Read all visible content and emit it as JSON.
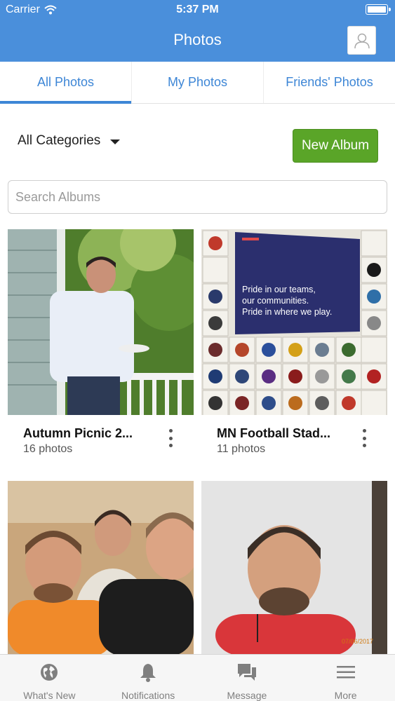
{
  "status_bar": {
    "carrier": "Carrier",
    "time": "5:37 PM"
  },
  "header": {
    "title": "Photos"
  },
  "tabs": [
    {
      "label": "All Photos",
      "active": true
    },
    {
      "label": "My Photos",
      "active": false
    },
    {
      "label": "Friends' Photos",
      "active": false
    }
  ],
  "controls": {
    "category": "All Categories",
    "new_album_label": "New Album",
    "search_placeholder": "Search Albums",
    "search_value": ""
  },
  "albums": [
    {
      "name": "Autumn Picnic 2...",
      "count": "16 photos"
    },
    {
      "name": "MN Football Stad...",
      "count": "11 photos"
    },
    {
      "name": "",
      "count": ""
    },
    {
      "name": "",
      "count": ""
    }
  ],
  "bottom_nav": [
    {
      "label": "What's New",
      "icon": "globe-icon"
    },
    {
      "label": "Notifications",
      "icon": "bell-icon"
    },
    {
      "label": "Message",
      "icon": "chat-bubbles-icon"
    },
    {
      "label": "More",
      "icon": "hamburger-menu-icon"
    }
  ],
  "colors": {
    "header": "#4a8fdb",
    "tab_active": "#3d86d6",
    "new_album": "#5aa528"
  }
}
